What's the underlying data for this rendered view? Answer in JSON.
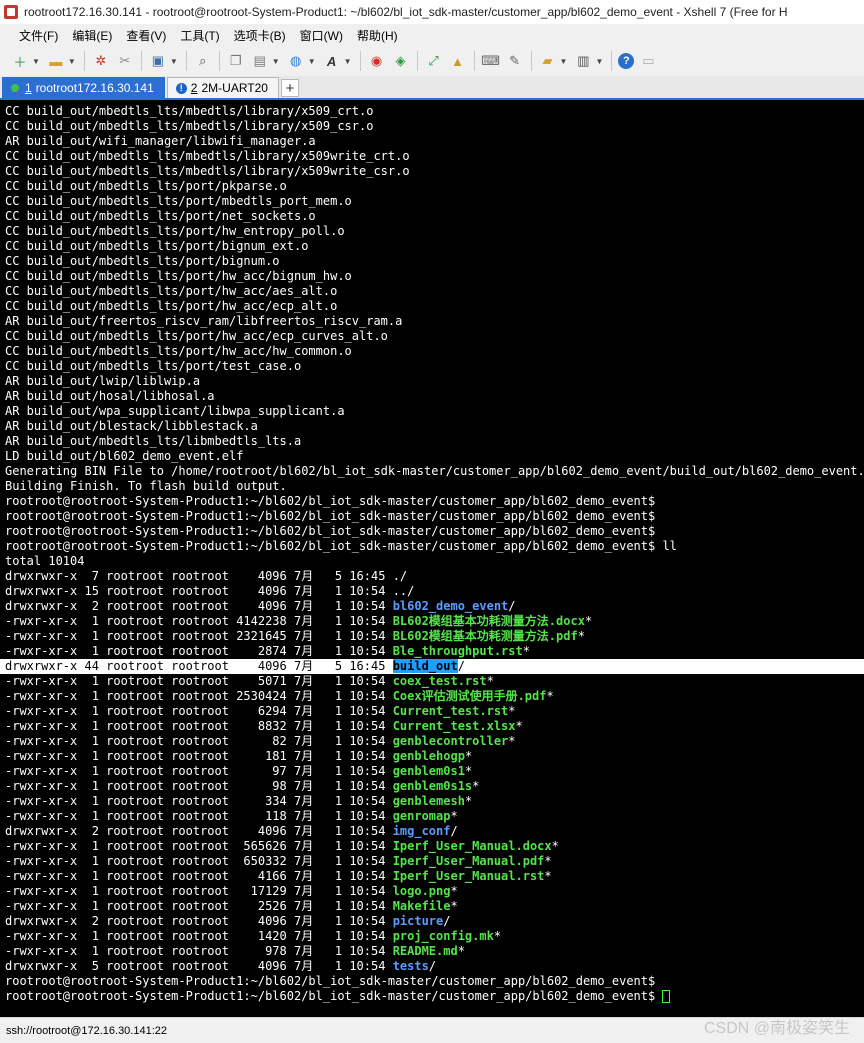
{
  "window": {
    "title": "rootroot172.16.30.141 - rootroot@rootroot-System-Product1: ~/bl602/bl_iot_sdk-master/customer_app/bl602_demo_event - Xshell 7 (Free for H"
  },
  "menu": [
    {
      "label": "文件(F)"
    },
    {
      "label": "编辑(E)"
    },
    {
      "label": "查看(V)"
    },
    {
      "label": "工具(T)"
    },
    {
      "label": "选项卡(B)"
    },
    {
      "label": "窗口(W)"
    },
    {
      "label": "帮助(H)"
    }
  ],
  "toolbar": {
    "icons": [
      "new-session-icon",
      "open-folder-icon",
      "reconnect-icon",
      "disconnect-icon",
      "properties-icon",
      "find-icon",
      "copy-icon",
      "paste-icon",
      "globe-icon",
      "font-icon",
      "xftp-icon",
      "xagent-icon",
      "fullscreen-icon",
      "lock-icon",
      "keyboard-icon",
      "compose-icon",
      "new-tab-group-icon",
      "layout-icon",
      "help-icon",
      "chat-icon"
    ]
  },
  "tabs": [
    {
      "number": "1",
      "label": "rootroot172.16.30.141",
      "active": true,
      "status": "connected"
    },
    {
      "number": "2",
      "label": "2M-UART20",
      "active": false,
      "status": "warning"
    }
  ],
  "tab_add_label": "+",
  "terminal": {
    "lines": [
      "CC build_out/mbedtls_lts/mbedtls/library/x509_crt.o",
      "CC build_out/mbedtls_lts/mbedtls/library/x509_csr.o",
      "AR build_out/wifi_manager/libwifi_manager.a",
      "CC build_out/mbedtls_lts/mbedtls/library/x509write_crt.o",
      "CC build_out/mbedtls_lts/mbedtls/library/x509write_csr.o",
      "CC build_out/mbedtls_lts/port/pkparse.o",
      "CC build_out/mbedtls_lts/port/mbedtls_port_mem.o",
      "CC build_out/mbedtls_lts/port/net_sockets.o",
      "CC build_out/mbedtls_lts/port/hw_entropy_poll.o",
      "CC build_out/mbedtls_lts/port/bignum_ext.o",
      "CC build_out/mbedtls_lts/port/bignum.o",
      "CC build_out/mbedtls_lts/port/hw_acc/bignum_hw.o",
      "CC build_out/mbedtls_lts/port/hw_acc/aes_alt.o",
      "CC build_out/mbedtls_lts/port/hw_acc/ecp_alt.o",
      "AR build_out/freertos_riscv_ram/libfreertos_riscv_ram.a",
      "CC build_out/mbedtls_lts/port/hw_acc/ecp_curves_alt.o",
      "CC build_out/mbedtls_lts/port/hw_acc/hw_common.o",
      "CC build_out/mbedtls_lts/port/test_case.o",
      "AR build_out/lwip/liblwip.a",
      "AR build_out/hosal/libhosal.a",
      "AR build_out/wpa_supplicant/libwpa_supplicant.a",
      "AR build_out/blestack/libblestack.a",
      "AR build_out/mbedtls_lts/libmbedtls_lts.a",
      "LD build_out/bl602_demo_event.elf",
      "Generating BIN File to /home/rootroot/bl602/bl_iot_sdk-master/customer_app/bl602_demo_event/build_out/bl602_demo_event.bin",
      "Building Finish. To flash build output.",
      "rootroot@rootroot-System-Product1:~/bl602/bl_iot_sdk-master/customer_app/bl602_demo_event$",
      "rootroot@rootroot-System-Product1:~/bl602/bl_iot_sdk-master/customer_app/bl602_demo_event$",
      "rootroot@rootroot-System-Product1:~/bl602/bl_iot_sdk-master/customer_app/bl602_demo_event$",
      "rootroot@rootroot-System-Product1:~/bl602/bl_iot_sdk-master/customer_app/bl602_demo_event$ ll",
      "total 10104"
    ],
    "listing": [
      {
        "prefix": "drwxrwxr-x  7 rootroot rootroot    4096 7月   5 16:45 ",
        "name": "./",
        "kind": "plain"
      },
      {
        "prefix": "drwxrwxr-x 15 rootroot rootroot    4096 7月   1 10:54 ",
        "name": "../",
        "kind": "plain"
      },
      {
        "prefix": "drwxrwxr-x  2 rootroot rootroot    4096 7月   1 10:54 ",
        "name": "bl602_demo_event",
        "suffix": "/",
        "kind": "dir"
      },
      {
        "prefix": "-rwxr-xr-x  1 rootroot rootroot 4142238 7月   1 10:54 ",
        "name": "BL602模组基本功耗测量方法.docx",
        "suffix": "*",
        "kind": "exe"
      },
      {
        "prefix": "-rwxr-xr-x  1 rootroot rootroot 2321645 7月   1 10:54 ",
        "name": "BL602模组基本功耗测量方法.pdf",
        "suffix": "*",
        "kind": "exe"
      },
      {
        "prefix": "-rwxr-xr-x  1 rootroot rootroot    2874 7月   1 10:54 ",
        "name": "Ble_throughput.rst",
        "suffix": "*",
        "kind": "exe"
      },
      {
        "prefix": "drwxrwxr-x 44 rootroot rootroot    4096 7月   5 16:45 ",
        "name": "build_out",
        "suffix": "/",
        "kind": "selected"
      },
      {
        "prefix": "-rwxr-xr-x  1 rootroot rootroot    5071 7月   1 10:54 ",
        "name": "coex_test.rst",
        "suffix": "*",
        "kind": "exe"
      },
      {
        "prefix": "-rwxr-xr-x  1 rootroot rootroot 2530424 7月   1 10:54 ",
        "name": "Coex评估测试使用手册.pdf",
        "suffix": "*",
        "kind": "exe"
      },
      {
        "prefix": "-rwxr-xr-x  1 rootroot rootroot    6294 7月   1 10:54 ",
        "name": "Current_test.rst",
        "suffix": "*",
        "kind": "exe"
      },
      {
        "prefix": "-rwxr-xr-x  1 rootroot rootroot    8832 7月   1 10:54 ",
        "name": "Current_test.xlsx",
        "suffix": "*",
        "kind": "exe"
      },
      {
        "prefix": "-rwxr-xr-x  1 rootroot rootroot      82 7月   1 10:54 ",
        "name": "genblecontroller",
        "suffix": "*",
        "kind": "exe"
      },
      {
        "prefix": "-rwxr-xr-x  1 rootroot rootroot     181 7月   1 10:54 ",
        "name": "genblehogp",
        "suffix": "*",
        "kind": "exe"
      },
      {
        "prefix": "-rwxr-xr-x  1 rootroot rootroot      97 7月   1 10:54 ",
        "name": "genblem0s1",
        "suffix": "*",
        "kind": "exe"
      },
      {
        "prefix": "-rwxr-xr-x  1 rootroot rootroot      98 7月   1 10:54 ",
        "name": "genblem0s1s",
        "suffix": "*",
        "kind": "exe"
      },
      {
        "prefix": "-rwxr-xr-x  1 rootroot rootroot     334 7月   1 10:54 ",
        "name": "genblemesh",
        "suffix": "*",
        "kind": "exe"
      },
      {
        "prefix": "-rwxr-xr-x  1 rootroot rootroot     118 7月   1 10:54 ",
        "name": "genromap",
        "suffix": "*",
        "kind": "exe"
      },
      {
        "prefix": "drwxrwxr-x  2 rootroot rootroot    4096 7月   1 10:54 ",
        "name": "img_conf",
        "suffix": "/",
        "kind": "dir"
      },
      {
        "prefix": "-rwxr-xr-x  1 rootroot rootroot  565626 7月   1 10:54 ",
        "name": "Iperf_User_Manual.docx",
        "suffix": "*",
        "kind": "exe"
      },
      {
        "prefix": "-rwxr-xr-x  1 rootroot rootroot  650332 7月   1 10:54 ",
        "name": "Iperf_User_Manual.pdf",
        "suffix": "*",
        "kind": "exe"
      },
      {
        "prefix": "-rwxr-xr-x  1 rootroot rootroot    4166 7月   1 10:54 ",
        "name": "Iperf_User_Manual.rst",
        "suffix": "*",
        "kind": "exe"
      },
      {
        "prefix": "-rwxr-xr-x  1 rootroot rootroot   17129 7月   1 10:54 ",
        "name": "logo.png",
        "suffix": "*",
        "kind": "exe"
      },
      {
        "prefix": "-rwxr-xr-x  1 rootroot rootroot    2526 7月   1 10:54 ",
        "name": "Makefile",
        "suffix": "*",
        "kind": "exe"
      },
      {
        "prefix": "drwxrwxr-x  2 rootroot rootroot    4096 7月   1 10:54 ",
        "name": "picture",
        "suffix": "/",
        "kind": "dir"
      },
      {
        "prefix": "-rwxr-xr-x  1 rootroot rootroot    1420 7月   1 10:54 ",
        "name": "proj_config.mk",
        "suffix": "*",
        "kind": "exe"
      },
      {
        "prefix": "-rwxr-xr-x  1 rootroot rootroot     978 7月   1 10:54 ",
        "name": "README.md",
        "suffix": "*",
        "kind": "exe"
      },
      {
        "prefix": "drwxrwxr-x  5 rootroot rootroot    4096 7月   1 10:54 ",
        "name": "tests",
        "suffix": "/",
        "kind": "dir"
      }
    ],
    "tail_lines": [
      "rootroot@rootroot-System-Product1:~/bl602/bl_iot_sdk-master/customer_app/bl602_demo_event$",
      "rootroot@rootroot-System-Product1:~/bl602/bl_iot_sdk-master/customer_app/bl602_demo_event$ "
    ],
    "colors": {
      "background": "#000000",
      "text": "#ffffff",
      "directory": "#5b9cff",
      "executable": "#54e44a",
      "selection": "#1e9fff",
      "cursor": "#3cff3c"
    }
  },
  "status": {
    "text": "ssh://rootroot@172.16.30.141:22"
  },
  "watermark": "CSDN @南极姿笑生"
}
